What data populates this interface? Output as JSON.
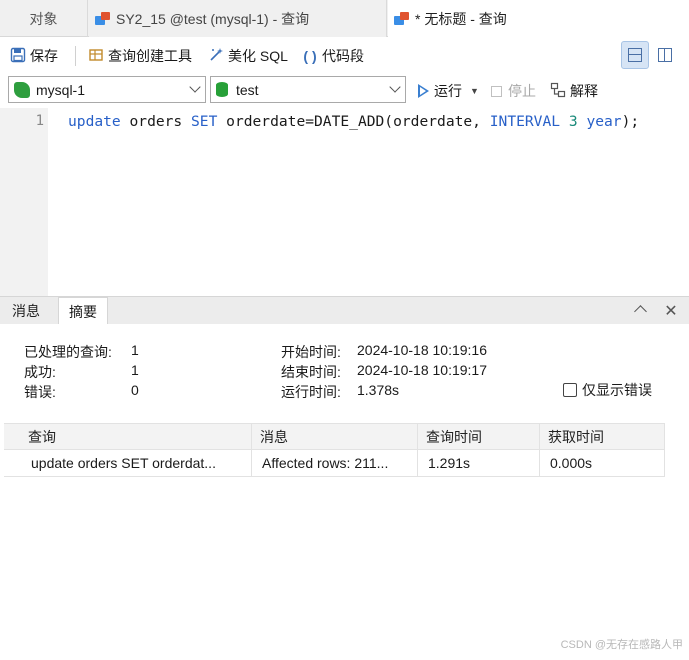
{
  "tabs": {
    "objects_label": "对象",
    "tab1_label": "SY2_15 @test (mysql-1) - 查询",
    "tab2_label": "* 无标题 - 查询"
  },
  "toolbar": {
    "save_label": "保存",
    "query_builder_label": "查询创建工具",
    "beautify_label": "美化 SQL",
    "snippet_label": "代码段"
  },
  "connection": {
    "connection_value": "mysql-1",
    "database_value": "test",
    "run_label": "运行",
    "stop_label": "停止",
    "explain_label": "解释"
  },
  "editor": {
    "line_number": "1",
    "sql": {
      "t1": "update",
      "t2": " orders ",
      "t3": "SET",
      "t4": " orderdate=DATE_ADD(orderdate, ",
      "t5": "INTERVAL",
      "t6": " ",
      "t7": "3",
      "t8": " ",
      "t9": "year",
      "t10": ");"
    }
  },
  "panel": {
    "tab_messages": "消息",
    "tab_summary": "摘要"
  },
  "summary": {
    "processed_label": "已处理的查询:",
    "processed_value": "1",
    "success_label": "成功:",
    "success_value": "1",
    "error_label": "错误:",
    "error_value": "0",
    "start_label": "开始时间:",
    "start_value": "2024-10-18 10:19:16",
    "end_label": "结束时间:",
    "end_value": "2024-10-18 10:19:17",
    "runtime_label": "运行时间:",
    "runtime_value": "1.378s",
    "only_errors_label": "仅显示错误"
  },
  "results": {
    "columns": [
      "查询",
      "消息",
      "查询时间",
      "获取时间"
    ],
    "rows": [
      [
        "update orders SET orderdat...",
        "Affected rows: 211...",
        "1.291s",
        "0.000s"
      ]
    ]
  },
  "watermark": "CSDN @无存在感路人甲",
  "colors": {
    "keyword": "#2860c8",
    "number": "#1a8a7a",
    "accent": "#3a7fd0"
  }
}
